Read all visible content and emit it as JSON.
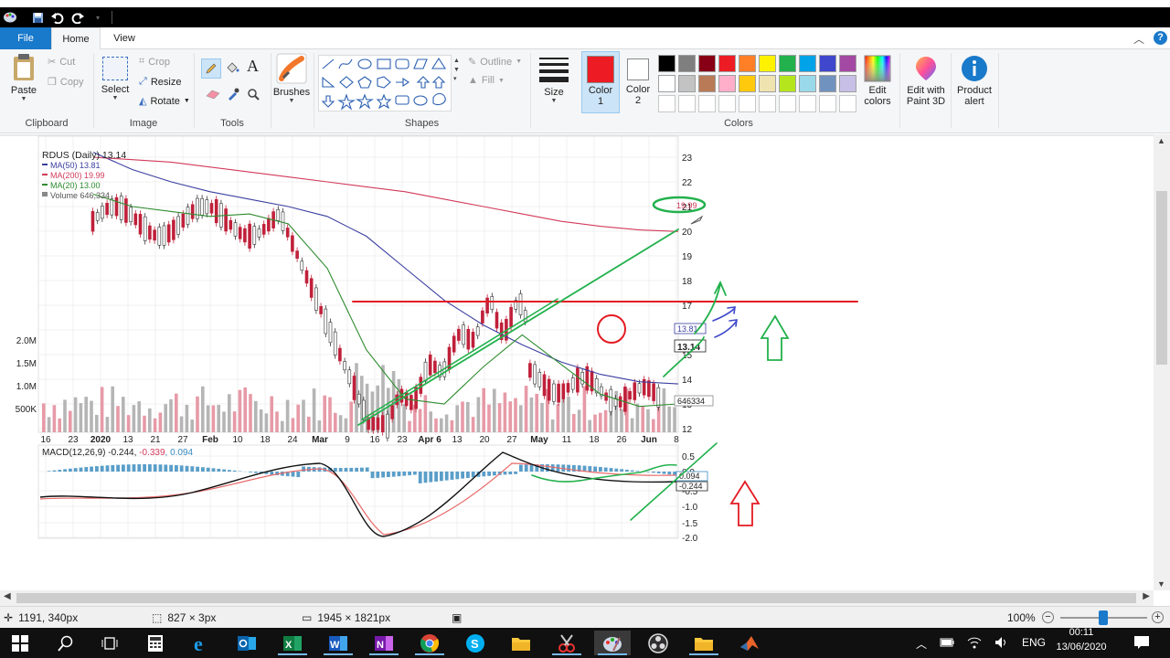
{
  "ribbon": {
    "tabs": [
      {
        "label": "File"
      },
      {
        "label": "Home"
      },
      {
        "label": "View"
      }
    ],
    "clipboard": {
      "paste": "Paste",
      "cut": "Cut",
      "copy": "Copy",
      "group": "Clipboard"
    },
    "image": {
      "select": "Select",
      "crop": "Crop",
      "resize": "Resize",
      "rotate": "Rotate",
      "group": "Image"
    },
    "tools": {
      "group": "Tools",
      "text_tool": "A"
    },
    "brushes": {
      "label": "Brushes"
    },
    "shapes": {
      "outline": "Outline",
      "fill": "Fill",
      "group": "Shapes"
    },
    "size": {
      "label": "Size"
    },
    "color1": {
      "label": "Color",
      "num": "1",
      "value": "#ed1c24"
    },
    "color2": {
      "label": "Color",
      "num": "2",
      "value": "#ffffff"
    },
    "colors_group": "Colors",
    "edit_colors": {
      "line1": "Edit",
      "line2": "colors"
    },
    "paint3d": {
      "line1": "Edit with",
      "line2": "Paint 3D"
    },
    "product_alert": {
      "line1": "Product",
      "line2": "alert"
    },
    "palette_row1": [
      "#000000",
      "#7f7f7f",
      "#880015",
      "#ed1c24",
      "#ff7f27",
      "#fff200",
      "#22b14c",
      "#00a2e8",
      "#3f48cc",
      "#a349a4"
    ],
    "palette_row2": [
      "#ffffff",
      "#c3c3c3",
      "#b97a57",
      "#ffaec9",
      "#ffc90e",
      "#efe4b0",
      "#b5e61d",
      "#99d9ea",
      "#7092be",
      "#c8bfe7"
    ]
  },
  "chart": {
    "ticker": "RDUS (Daily) 13.14",
    "legend": [
      {
        "label": "MA(50) 13.81",
        "color": "#3b3fa0"
      },
      {
        "label": "MA(200) 19.99",
        "color": "#d23a5a"
      },
      {
        "label": "MA(20) 13.00",
        "color": "#2e8b2e"
      },
      {
        "label": "Volume 646,334",
        "color": "#555555"
      }
    ],
    "macd_label": "MACD(12,26,9) -0.244, ",
    "macd_signal": "-0.339",
    "macd_hist": ", 0.094",
    "price_ticks": [
      "23",
      "22",
      "21",
      "20",
      "19",
      "18",
      "17",
      "16",
      "15",
      "14",
      "13",
      "12"
    ],
    "volume_ticks": [
      "2.0M",
      "1.5M",
      "1.0M",
      "500K"
    ],
    "macd_ticks": [
      "0.5",
      "0.0",
      "-0.5",
      "-1.0",
      "-1.5",
      "-2.0"
    ],
    "x_ticks": [
      "16",
      "23",
      "2020",
      "13",
      "21",
      "27",
      "Feb",
      "10",
      "18",
      "24",
      "Mar",
      "9",
      "16",
      "23",
      "Apr 6",
      "13",
      "20",
      "27",
      "May",
      "11",
      "18",
      "26",
      "Jun",
      "8"
    ],
    "price_tags": {
      "ma200": "19.99",
      "ma50": "13.81",
      "last": "13.14",
      "volume": "646334",
      "macd1": "0.094",
      "macd2": "-0.244"
    }
  },
  "chart_data": {
    "type": "line",
    "title": "RDUS (Daily) 13.14",
    "ylim": [
      12,
      23
    ],
    "series": [
      {
        "name": "MA(50) 13.81",
        "values": [
          23.2,
          22.5,
          22.0,
          21.6,
          21.3,
          21.0,
          20.6,
          19.8,
          18.5,
          17.2,
          16.2,
          15.4,
          14.7,
          14.2,
          13.9,
          13.81
        ]
      },
      {
        "name": "MA(200) 19.99",
        "values": [
          23.0,
          22.9,
          22.8,
          22.6,
          22.4,
          22.2,
          22.0,
          21.8,
          21.6,
          21.3,
          21.0,
          20.7,
          20.4,
          20.2,
          20.05,
          19.99
        ]
      },
      {
        "name": "MA(20) 13.00",
        "values": [
          21.5,
          21.0,
          20.8,
          20.6,
          20.7,
          20.3,
          18.5,
          15.2,
          13.2,
          13.0,
          14.5,
          15.8,
          14.6,
          13.4,
          12.9,
          13.0
        ]
      }
    ]
  },
  "status": {
    "cursor": "1191, 340px",
    "selection": "827 × 3px",
    "image_size": "1945 × 1821px",
    "zoom": "100%"
  },
  "taskbar": {
    "lang": "ENG",
    "time": "00:11",
    "date": "13/06/2020"
  }
}
